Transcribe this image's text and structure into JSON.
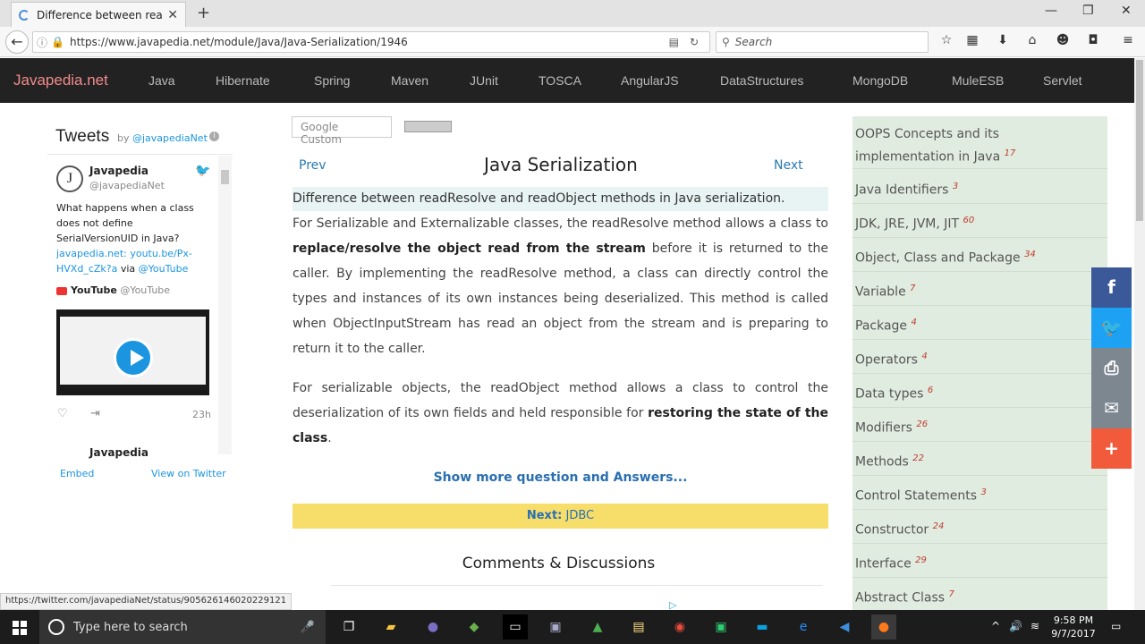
{
  "browser": {
    "tab_title": "Difference between readR...",
    "url": "https://www.javapedia.net/module/Java/Java-Serialization/1946",
    "search_placeholder": "Search",
    "status_url": "https://twitter.com/javapediaNet/status/905626146020229121"
  },
  "site": {
    "logo": "Javapedia.net",
    "nav": [
      "Java",
      "Hibernate",
      "Spring",
      "Maven",
      "JUnit",
      "TOSCA",
      "AngularJS",
      "DataStructures",
      "MongoDB",
      "MuleESB",
      "Servlet"
    ]
  },
  "tweets": {
    "title": "Tweets",
    "by": "by",
    "by_handle": "@javapediaNet",
    "name": "Javapedia",
    "handle": "@javapediaNet",
    "text1": "What happens when a class does not define SerialVersionUID in Java?",
    "link": "javapedia.net: youtu.be/Px-HVXd_cZk?a",
    "via": "via",
    "via_handle": "@YouTube",
    "yt_name": "YouTube",
    "yt_handle": "@YouTube",
    "time": "23h",
    "next_name": "Javapedia",
    "embed": "Embed",
    "view_on_twitter": "View on Twitter"
  },
  "main": {
    "google_custom": "Google Custom",
    "prev": "Prev",
    "next": "Next",
    "title": "Java Serialization",
    "question": "Difference between readResolve and readObject methods in Java serialization.",
    "p1_a": "For Serializable and Externalizable classes, the readResolve method allows a class to",
    "p1_b": "replace/resolve the object read from the stream",
    "p1_c": "before it is returned to the caller. By implementing the readResolve method, a class can directly control the types and instances of its own instances being deserialized. This method is called when ObjectInputStream has read an object from the stream and is preparing to return it to the caller.",
    "p2_a": "For serializable objects, the readObject method allows a class to control the deserialization of its own fields and held responsible for",
    "p2_b": "restoring the state of the class",
    "p2_c": ".",
    "show_more": "Show more question and Answers...",
    "next_label": "Next:",
    "next_topic": "JDBC",
    "comments": "Comments & Discussions"
  },
  "topics": [
    {
      "label": "OOPS Concepts and its implementation in Java",
      "count": "17"
    },
    {
      "label": "Java Identifiers",
      "count": "3"
    },
    {
      "label": "JDK, JRE, JVM, JIT",
      "count": "60"
    },
    {
      "label": "Object, Class and Package",
      "count": "34"
    },
    {
      "label": "Variable",
      "count": "7"
    },
    {
      "label": "Package",
      "count": "4"
    },
    {
      "label": "Operators",
      "count": "4"
    },
    {
      "label": "Data types",
      "count": "6"
    },
    {
      "label": "Modifiers",
      "count": "26"
    },
    {
      "label": "Methods",
      "count": "22"
    },
    {
      "label": "Control Statements",
      "count": "3"
    },
    {
      "label": "Constructor",
      "count": "24"
    },
    {
      "label": "Interface",
      "count": "29"
    },
    {
      "label": "Abstract Class",
      "count": "7"
    }
  ],
  "share_colors": {
    "facebook": "#3b5998",
    "twitter": "#1da1f2",
    "print": "#7d8790",
    "email": "#7d8790",
    "more": "#f25a3c"
  },
  "taskbar": {
    "search_placeholder": "Type here to search",
    "time": "9:58 PM",
    "date": "9/7/2017"
  }
}
